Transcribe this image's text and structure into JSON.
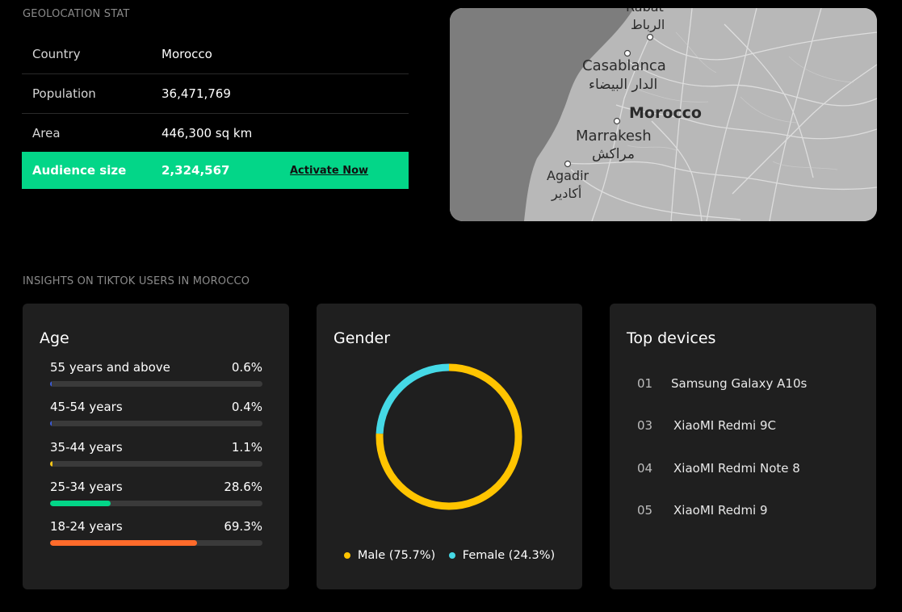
{
  "geo": {
    "section_title": "GEOLOCATION STAT",
    "rows": [
      {
        "label": "Country",
        "value": "Morocco"
      },
      {
        "label": "Population",
        "value": "36,471,769"
      },
      {
        "label": "Area",
        "value": "446,300 sq km"
      }
    ],
    "audience": {
      "label": "Audience size",
      "value": "2,324,567",
      "cta": "Activate Now"
    },
    "map": {
      "country_label": "Morocco",
      "cities": [
        {
          "name": "Rabat",
          "name_ar": "الرباط"
        },
        {
          "name": "Casablanca",
          "name_ar": "الدار البيضاء"
        },
        {
          "name": "Marrakesh",
          "name_ar": "مراكش"
        },
        {
          "name": "Agadir",
          "name_ar": "أكادير"
        }
      ]
    }
  },
  "insights": {
    "section_title": "INSIGHTS ON TIKTOK USERS IN MOROCCO",
    "age": {
      "title": "Age",
      "rows": [
        {
          "label": "55 years and above",
          "value": "0.6%",
          "percent": 0.6,
          "color": "#3b5bdb"
        },
        {
          "label": "45-54 years",
          "value": "0.4%",
          "percent": 0.4,
          "color": "#3b5bdb"
        },
        {
          "label": "35-44 years",
          "value": "1.1%",
          "percent": 1.1,
          "color": "#f5c518"
        },
        {
          "label": "25-34 years",
          "value": "28.6%",
          "percent": 28.6,
          "color": "#03d688"
        },
        {
          "label": "18-24 years",
          "value": "69.3%",
          "percent": 69.3,
          "color": "#ff6b2b"
        }
      ]
    },
    "gender": {
      "title": "Gender",
      "series": [
        {
          "label": "Male (75.7%)",
          "percent": 75.7,
          "color": "#ffc400"
        },
        {
          "label": "Female (24.3%)",
          "percent": 24.3,
          "color": "#45d9e6"
        }
      ]
    },
    "devices": {
      "title": "Top devices",
      "items": [
        {
          "rank": "01",
          "name": "Samsung Galaxy A10s"
        },
        {
          "rank": "03",
          "name": "XiaoMI Redmi 9C"
        },
        {
          "rank": "04",
          "name": "XiaoMI Redmi Note 8"
        },
        {
          "rank": "05",
          "name": "XiaoMI Redmi 9"
        }
      ]
    }
  }
}
